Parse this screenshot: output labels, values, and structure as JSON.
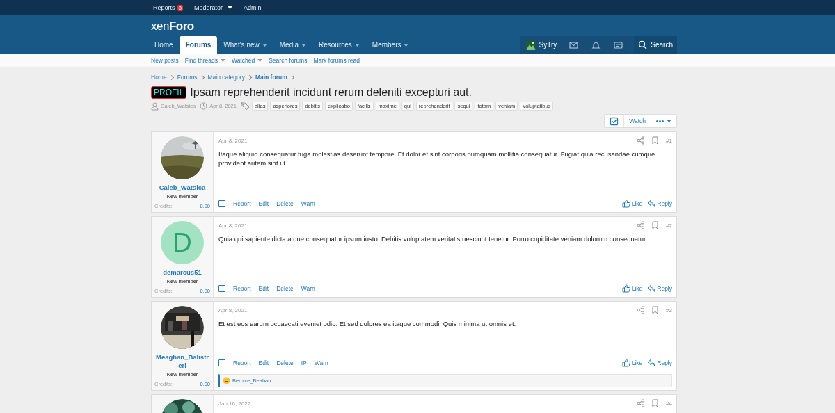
{
  "staff_bar": {
    "items": [
      {
        "label": "Reports",
        "badge": "3",
        "dropdown": false
      },
      {
        "label": "Moderator",
        "dropdown": true
      },
      {
        "label": "Admin",
        "dropdown": false
      }
    ]
  },
  "header": {
    "logo": "xen**Foro**"
  },
  "nav": {
    "tabs": [
      {
        "label": "Home",
        "selected": false,
        "dropdown": false
      },
      {
        "label": "Forums",
        "selected": true,
        "dropdown": false
      },
      {
        "label": "What's new",
        "selected": false,
        "dropdown": true
      },
      {
        "label": "Media",
        "selected": false,
        "dropdown": true
      },
      {
        "label": "Resources",
        "selected": false,
        "dropdown": true
      },
      {
        "label": "Members",
        "selected": false,
        "dropdown": true
      }
    ],
    "user": "SyTry",
    "search": "Search"
  },
  "sub_nav": {
    "items": [
      {
        "label": "New posts",
        "dropdown": false
      },
      {
        "label": "Find threads",
        "dropdown": true
      },
      {
        "label": "Watched",
        "dropdown": true
      },
      {
        "label": "Search forums",
        "dropdown": false
      },
      {
        "label": "Mark forums read",
        "dropdown": false
      }
    ]
  },
  "breadcrumbs": [
    {
      "label": "Home",
      "current": false
    },
    {
      "label": "Forums",
      "current": false
    },
    {
      "label": "Main category",
      "current": false
    },
    {
      "label": "Main forum",
      "current": true
    }
  ],
  "thread": {
    "prefix": "PROFIL",
    "title": "Ipsam reprehenderit incidunt rerum deleniti excepturi aut.",
    "author": "Caleb_Watsica",
    "date": "Apr 8, 2021",
    "tags": [
      "alias",
      "asperiores",
      "debitis",
      "explicabo",
      "facilis",
      "maxime",
      "qui",
      "reprehenderit",
      "sequi",
      "totam",
      "veniam",
      "voluptatibus"
    ],
    "watch": "Watch"
  },
  "posts": [
    {
      "avatar": {
        "kind": "picture"
      },
      "user": "Caleb_Watsica",
      "role": "New member",
      "credits_label": "Credits:",
      "credits": "0.00",
      "date": "Apr 8, 2021",
      "number": "#1",
      "body": "Itaque aliquid consequatur fuga molestias deserunt tempore. Et dolor et sint corporis numquam mollitia consequatur. Fugiat quia recusandae cumque provident autem sint ut.",
      "checked": false,
      "actions": [
        "Report",
        "Edit",
        "Delete",
        "Warn"
      ],
      "like": "Like",
      "reply": "Reply"
    },
    {
      "avatar": {
        "kind": "letter",
        "letter": "D"
      },
      "user": "demarcus51",
      "role": "New member",
      "credits_label": "Credits:",
      "credits": "0.00",
      "date": "Apr 8, 2021",
      "number": "#2",
      "body": "Quia qui sapiente dicta atque consequatur ipsum iusto. Debitis voluptatem veritatis nesciunt tenetur. Porro cupiditate veniam dolorum consequatur.",
      "checked": false,
      "actions": [
        "Report",
        "Edit",
        "Delete",
        "Warn"
      ],
      "like": "Like",
      "reply": "Reply"
    },
    {
      "avatar": {
        "kind": "picture"
      },
      "user": "Meaghan_Balistreri",
      "role": "New member",
      "credits_label": "Credits:",
      "credits": "0.00",
      "date": "Apr 8, 2021",
      "number": "#3",
      "body": "Et est eos earum occaecati eveniet odio. Et sed dolores ea itaque commodi. Quis minima ut omnis et.",
      "checked": false,
      "actions": [
        "Report",
        "Edit",
        "Delete",
        "IP",
        "Warn"
      ],
      "like": "Like",
      "reply": "Reply",
      "reactions": "Bernice_Beahan"
    },
    {
      "avatar": {
        "kind": "picture"
      },
      "date": "Jan 16, 2022",
      "number": "#4"
    }
  ]
}
